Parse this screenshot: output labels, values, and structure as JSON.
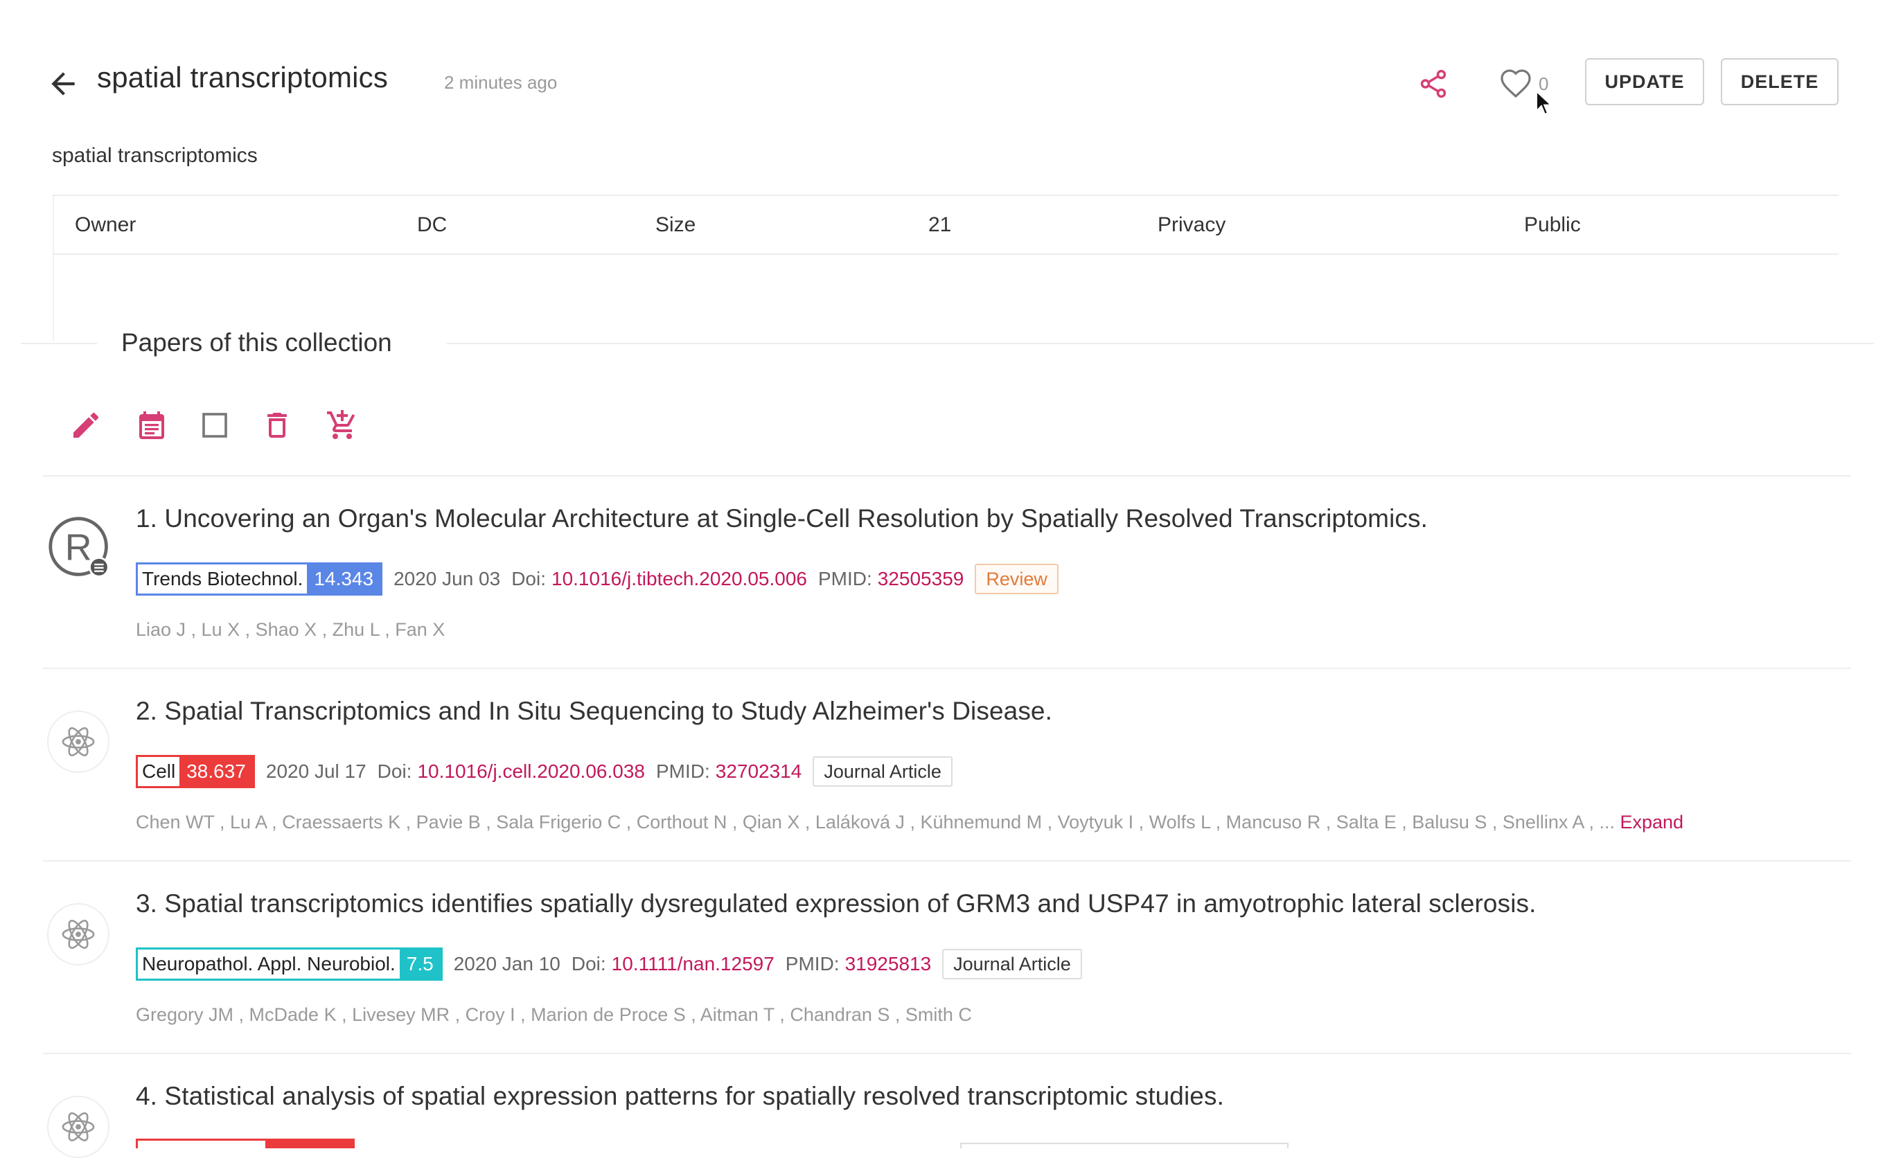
{
  "header": {
    "title": "spatial transcriptomics",
    "time_ago": "2 minutes ago",
    "like_count": "0",
    "update_label": "UPDATE",
    "delete_label": "DELETE",
    "description": "spatial transcriptomics"
  },
  "info": {
    "owner_label": "Owner",
    "owner_value": "DC",
    "size_label": "Size",
    "size_value": "21",
    "privacy_label": "Privacy",
    "privacy_value": "Public"
  },
  "section": {
    "title": "Papers of this collection"
  },
  "toolbar_icons": [
    "edit-icon",
    "calendar-icon",
    "checkbox-icon",
    "trash-icon",
    "add-to-cart-icon"
  ],
  "colors": {
    "accent": "#d63e75",
    "link": "#c2185b"
  },
  "papers": [
    {
      "title": "1. Uncovering an Organ's Molecular Architecture at Single-Cell Resolution by Spatially Resolved Transcriptomics.",
      "journal": "Trends Biotechnol.",
      "impact_factor": "14.343",
      "badge_color": "#5a86e6",
      "date": "2020 Jun 03",
      "doi_label": "Doi:",
      "doi": "10.1016/j.tibtech.2020.05.006",
      "pmid_label": "PMID:",
      "pmid": "32505359",
      "type": "Review",
      "authors": "Liao J , Lu X , Shao X , Zhu L , Fan X",
      "avatar": "registered-icon"
    },
    {
      "title": "2. Spatial Transcriptomics and In Situ Sequencing to Study Alzheimer's Disease.",
      "journal": "Cell",
      "impact_factor": "38.637",
      "badge_color": "#ec3b3b",
      "date": "2020 Jul 17",
      "doi_label": "Doi:",
      "doi": "10.1016/j.cell.2020.06.038",
      "pmid_label": "PMID:",
      "pmid": "32702314",
      "type": "Journal Article",
      "authors": "Chen WT , Lu A , Craessaerts K , Pavie B , Sala Frigerio C , Corthout N , Qian X , Laláková J , Kühnemund M , Voytyuk I , Wolfs L , Mancuso R , Salta E , Balusu S , Snellinx A , ...",
      "expand_label": "Expand",
      "avatar": "atom-icon"
    },
    {
      "title": "3. Spatial transcriptomics identifies spatially dysregulated expression of GRM3 and USP47 in amyotrophic lateral sclerosis.",
      "journal": "Neuropathol. Appl. Neurobiol.",
      "impact_factor": "7.5",
      "badge_color": "#1fc2c8",
      "date": "2020 Jan 10",
      "doi_label": "Doi:",
      "doi": "10.1111/nan.12597",
      "pmid_label": "PMID:",
      "pmid": "31925813",
      "type": "Journal Article",
      "authors": "Gregory JM , McDade K , Livesey MR , Croy I , Marion de Proce S , Aitman T , Chandran S , Smith C",
      "avatar": "atom-icon"
    },
    {
      "title": "4. Statistical analysis of spatial expression patterns for spatially resolved transcriptomic studies.",
      "avatar": "atom-icon"
    }
  ]
}
